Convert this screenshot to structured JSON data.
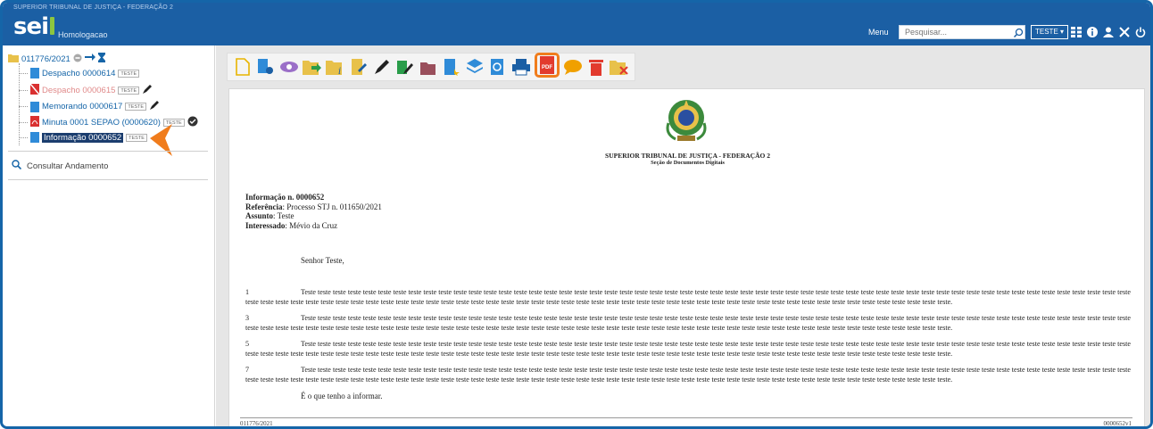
{
  "header": {
    "org_line": "SUPERIOR TRIBUNAL DE JUSTIÇA - FEDERAÇÃO 2",
    "logo": "sei",
    "environment": "Homologacao",
    "menu_label": "Menu",
    "search_placeholder": "Pesquisar...",
    "unit_badge": "TESTE",
    "icons": [
      "grid-icon",
      "info-icon",
      "user-icon",
      "tools-icon",
      "power-icon"
    ]
  },
  "tree": {
    "process": "011776/2021",
    "items": [
      {
        "label": "Despacho 0000614",
        "tag": "TESTE",
        "icon": "document-icon"
      },
      {
        "label": "Despacho 0000615",
        "tag": "TESTE",
        "icon": "canceled-document-icon"
      },
      {
        "label": "Memorando 0000617",
        "tag": "TESTE",
        "icon": "document-icon"
      },
      {
        "label": "Minuta 0001 SEPAO (0000620)",
        "tag": "TESTE",
        "icon": "pdf-icon"
      },
      {
        "label": "Informação 0000652",
        "tag": "TESTE",
        "icon": "document-icon"
      }
    ],
    "consultar": "Consultar Andamento"
  },
  "toolbar": {
    "buttons": [
      "new-document-icon",
      "document-settings-icon",
      "view-icon",
      "forward-icon",
      "process-info-icon",
      "edit-document-icon",
      "sign-icon",
      "sign-block-icon",
      "attach-icon",
      "bookmark-icon",
      "layers-icon",
      "refresh-icon",
      "print-icon",
      "pdf-icon",
      "comment-icon",
      "delete-icon",
      "close-folder-icon"
    ],
    "highlighted": "pdf-icon",
    "pdf_text": "PDF"
  },
  "document": {
    "org": "SUPERIOR TRIBUNAL DE JUSTIÇA - FEDERAÇÃO 2",
    "section": "Seção de Documentos Digitais",
    "title": "Informação n. 0000652",
    "ref_label": "Referência",
    "ref_value": ": Processo STJ n. 011650/2021",
    "subject_label": "Assunto",
    "subject_value": ": Teste",
    "interested_label": "Interessado",
    "interested_value": ": Mévio da Cruz",
    "salutation": "Senhor Teste,",
    "paragraphs": [
      {
        "num": "1",
        "text": "Teste teste teste teste teste teste teste teste teste teste teste teste teste teste teste teste teste teste teste teste teste teste teste teste teste teste teste teste teste teste teste teste teste teste teste teste teste teste teste teste teste teste teste teste teste teste teste teste teste teste teste teste teste teste teste teste teste teste teste teste teste teste teste teste teste teste teste teste teste teste teste teste teste teste teste teste teste teste teste teste teste teste teste teste teste teste teste teste teste teste teste teste teste teste teste teste teste teste teste teste teste teste."
      },
      {
        "num": "3",
        "text": "Teste teste teste teste teste teste teste teste teste teste teste teste teste teste teste teste teste teste teste teste teste teste teste teste teste teste teste teste teste teste teste teste teste teste teste teste teste teste teste teste teste teste teste teste teste teste teste teste teste teste teste teste teste teste teste teste teste teste teste teste teste teste teste teste teste teste teste teste teste teste teste teste teste teste teste teste teste teste teste teste teste teste teste teste teste teste teste teste teste teste teste teste teste teste teste teste teste teste teste teste teste teste."
      },
      {
        "num": "5",
        "text": "Teste teste teste teste teste teste teste teste teste teste teste teste teste teste teste teste teste teste teste teste teste teste teste teste teste teste teste teste teste teste teste teste teste teste teste teste teste teste teste teste teste teste teste teste teste teste teste teste teste teste teste teste teste teste teste teste teste teste teste teste teste teste teste teste teste teste teste teste teste teste teste teste teste teste teste teste teste teste teste teste teste teste teste teste teste teste teste teste teste teste teste teste teste teste teste teste teste teste teste teste teste teste."
      },
      {
        "num": "7",
        "text": "Teste teste teste teste teste teste teste teste teste teste teste teste teste teste teste teste teste teste teste teste teste teste teste teste teste teste teste teste teste teste teste teste teste teste teste teste teste teste teste teste teste teste teste teste teste teste teste teste teste teste teste teste teste teste teste teste teste teste teste teste teste teste teste teste teste teste teste teste teste teste teste teste teste teste teste teste teste teste teste teste teste teste teste teste teste teste teste teste teste teste teste teste teste teste teste teste teste teste teste teste teste teste."
      }
    ],
    "closing": "É o que tenho a informar.",
    "footer_left": "011776/2021",
    "footer_right": "0000652v1"
  },
  "colors": {
    "header": "#1b5fa4",
    "accent": "#f07c1c",
    "link": "#1565a8"
  }
}
